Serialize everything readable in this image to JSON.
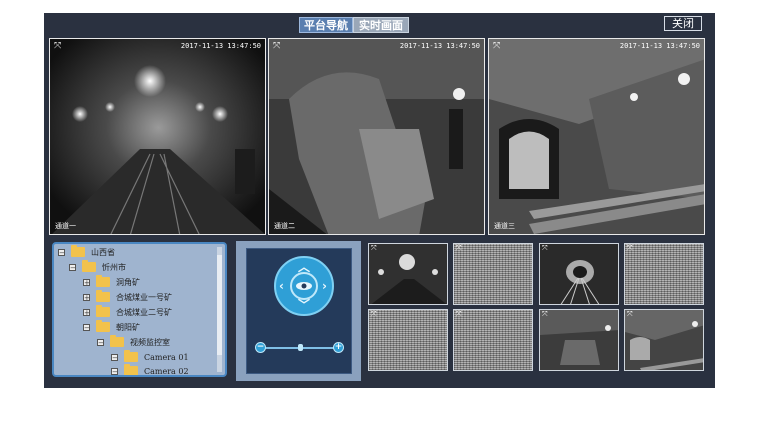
{
  "header": {
    "tabs": [
      {
        "label": "平台导航",
        "active": true
      },
      {
        "label": "实时画面",
        "active": false
      }
    ],
    "close_label": "关闭"
  },
  "cameras": [
    {
      "timestamp": "2017-11-13 13:47:50",
      "channel": "通道一"
    },
    {
      "timestamp": "2017-11-13 13:47:50",
      "channel": "通道二"
    },
    {
      "timestamp": "2017-11-13 13:47:50",
      "channel": "通道三"
    }
  ],
  "tree": {
    "nodes": [
      {
        "label": "山西省",
        "toggle": "⊟"
      },
      {
        "label": "忻州市",
        "toggle": "⊟"
      },
      {
        "label": "洞角矿",
        "toggle": "⊞"
      },
      {
        "label": "合城煤业一号矿",
        "toggle": "⊞"
      },
      {
        "label": "合城煤业二号矿",
        "toggle": "⊞"
      },
      {
        "label": "朝阳矿",
        "toggle": "⊟"
      },
      {
        "label": "视频监控室",
        "toggle": "⊟"
      },
      {
        "label": "Camera 01",
        "toggle": "⊟"
      },
      {
        "label": "Camera 02",
        "toggle": "⊟"
      }
    ]
  },
  "ptz": {
    "zoom_minus": "−",
    "zoom_plus": "+",
    "zoom_level": 0.5,
    "icons": [
      "ptz-up-icon",
      "ptz-down-icon",
      "ptz-left-icon",
      "ptz-right-icon",
      "eye-icon"
    ]
  },
  "colors": {
    "frame_bg": "#2a3140",
    "tab_active": "#5a7fb0",
    "tree_bg": "#9fb4cf",
    "ptz_ring": "#2f9fd6"
  }
}
